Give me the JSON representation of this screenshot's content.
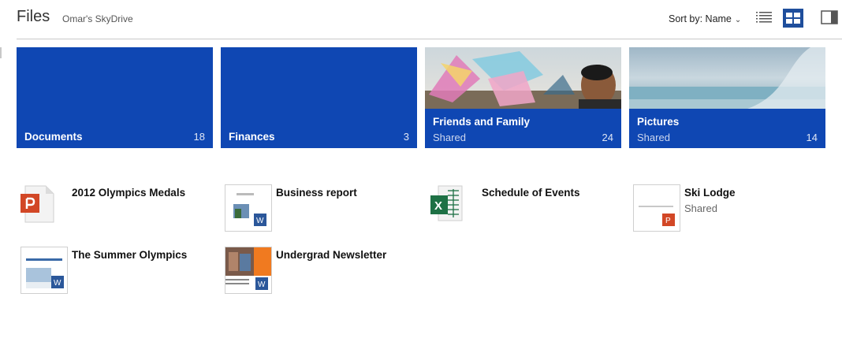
{
  "header": {
    "title": "Files",
    "location": "Omar's SkyDrive",
    "sort_label": "Sort by: Name"
  },
  "folders": [
    {
      "name": "Documents",
      "count": "18",
      "status": ""
    },
    {
      "name": "Finances",
      "count": "3",
      "status": ""
    },
    {
      "name": "Friends and Family",
      "count": "24",
      "status": "Shared"
    },
    {
      "name": "Pictures",
      "count": "14",
      "status": "Shared"
    }
  ],
  "files": [
    {
      "name": "2012 Olympics Medals",
      "status": "",
      "icon": "powerpoint-icon"
    },
    {
      "name": "Business report",
      "status": "",
      "icon": "word-icon"
    },
    {
      "name": "Schedule of Events",
      "status": "",
      "icon": "excel-icon"
    },
    {
      "name": "Ski Lodge",
      "status": "Shared",
      "icon": "powerpoint-icon"
    },
    {
      "name": "The Summer Olympics",
      "status": "",
      "icon": "word-icon"
    },
    {
      "name": "Undergrad Newsletter",
      "status": "",
      "icon": "word-icon"
    }
  ],
  "colors": {
    "folder_tile": "#0f47b3",
    "selected_view": "#1f4e9c",
    "powerpoint": "#d24726",
    "excel": "#1e7145",
    "word": "#2b579a"
  }
}
